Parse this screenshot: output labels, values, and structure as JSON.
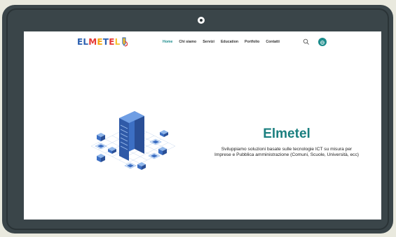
{
  "site": {
    "logo_text": "ELMETEL",
    "nav": [
      {
        "label": "Home",
        "active": true
      },
      {
        "label": "Chi siamo"
      },
      {
        "label": "Servizi"
      },
      {
        "label": "Education"
      },
      {
        "label": "Portfolio"
      },
      {
        "label": "Contatti"
      }
    ],
    "icons": {
      "search": "search-icon",
      "language": "globe-icon"
    },
    "colors": {
      "accent": "#1c8c8c",
      "tablet_frame": "#3a4549",
      "background": "#e9e9de"
    }
  },
  "hero": {
    "title": "Elmetel",
    "subtitle_line1": "Sviluppiamo soluzioni basate sulle tecnologie ICT su misura per",
    "subtitle_line2": "Imprese e Pubblica amministrazione (Comuni, Scuole, Università, ecc)"
  }
}
